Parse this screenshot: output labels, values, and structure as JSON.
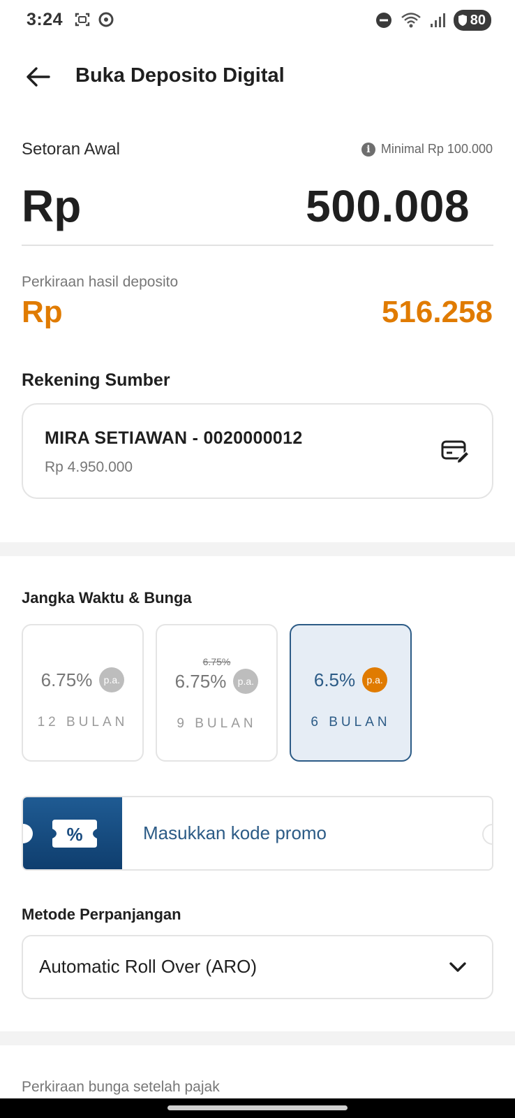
{
  "status_bar": {
    "time": "3:24",
    "battery": "80"
  },
  "header": {
    "title": "Buka Deposito Digital"
  },
  "deposit": {
    "label": "Setoran Awal",
    "minimum_note": "Minimal Rp 100.000",
    "currency": "Rp",
    "amount": "500.008"
  },
  "estimate": {
    "label": "Perkiraan hasil deposito",
    "currency": "Rp",
    "amount": "516.258"
  },
  "source_account": {
    "label": "Rekening Sumber",
    "name": "MIRA SETIAWAN - 0020000012",
    "balance": "Rp 4.950.000"
  },
  "terms": {
    "label": "Jangka Waktu & Bunga",
    "options": [
      {
        "rate": "6.75%",
        "badge": "p.a.",
        "old_rate": "",
        "period": "12 BULAN",
        "selected": false
      },
      {
        "rate": "6.75%",
        "badge": "p.a.",
        "old_rate": "6.75%",
        "period": "9 BULAN",
        "selected": false
      },
      {
        "rate": "6.5%",
        "badge": "p.a.",
        "old_rate": "",
        "period": "6 BULAN",
        "selected": true
      }
    ]
  },
  "promo": {
    "icon_symbol": "%",
    "placeholder": "Masukkan kode promo"
  },
  "renewal": {
    "label": "Metode Perpanjangan",
    "selected": "Automatic Roll Over (ARO)"
  },
  "interest": {
    "label": "Perkiraan bunga setelah pajak"
  },
  "colors": {
    "accent_orange": "#e07b00",
    "primary_blue": "#2c5b86",
    "selected_bg": "#e6edf5"
  }
}
